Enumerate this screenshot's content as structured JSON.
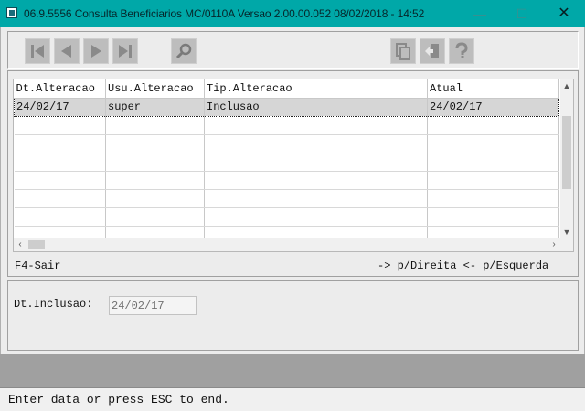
{
  "window": {
    "title": "06.9.5556 Consulta  Beneficiarios MC/0110A Versao 2.00.00.052 08/02/2018 - 14:52",
    "minimize_glyph": "—",
    "maximize_glyph": "☐",
    "close_glyph": "✕"
  },
  "toolbar": {
    "buttons": [
      "first-record-icon",
      "previous-record-icon",
      "next-record-icon",
      "last-record-icon",
      "search-icon",
      "copy-icon",
      "exit-door-icon",
      "help-icon"
    ]
  },
  "grid": {
    "columns": [
      "Dt.Alteracao",
      "Usu.Alteracao",
      "Tip.Alteracao",
      "Atual"
    ],
    "rows": [
      [
        "24/02/17",
        "super",
        "Inclusao",
        "24/02/17"
      ]
    ],
    "empty_rows": 7
  },
  "hints": {
    "exit": "F4-Sair",
    "navigate": "-> p/Direita  <- p/Esquerda"
  },
  "form": {
    "inclusao_label": "Dt.Inclusao:",
    "inclusao_value": "24/02/17"
  },
  "status": {
    "message": "Enter data or press ESC to end."
  },
  "colors": {
    "titlebar": "#00a8a8",
    "toolbar_button": "#bdbdbd",
    "selected_row": "#d6d6d6"
  }
}
